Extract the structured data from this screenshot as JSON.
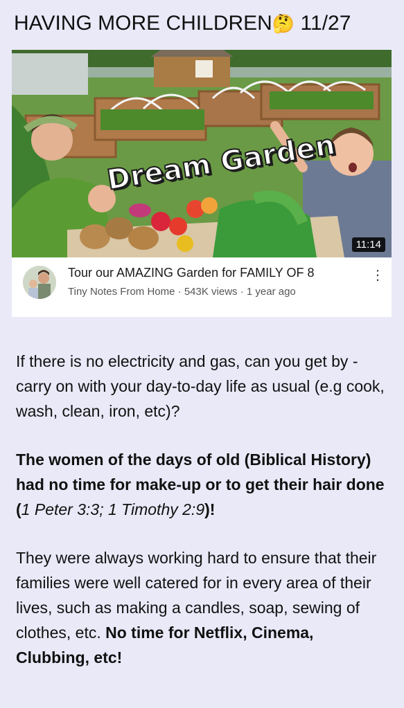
{
  "header": {
    "title": "HAVING MORE CHILDREN",
    "emoji": "🤔",
    "page_counter": "11/27"
  },
  "video": {
    "thumbnail_text": "Dream Garden",
    "duration": "11:14",
    "title": "Tour our AMAZING Garden for FAMILY OF 8",
    "channel": "Tiny Notes From Home",
    "views": "543K views",
    "age": "1 year ago",
    "separator": " · ",
    "menu_icon": "more-vertical-icon"
  },
  "paragraphs": {
    "p1": "If there is no electricity and gas, can you get by - carry on with your day-to-day life as usual (e.g cook, wash, clean, iron, etc)?",
    "p2_bold": "The women of the days of old (Biblical History) had no time for make-up or to get their hair done (",
    "p2_ref": "1 Peter 3:3; 1 Timothy 2:9",
    "p2_end": ")!",
    "p3_regular": "They were always working hard to ensure that their families were well catered for in every area of their lives, such as making a candles, soap, sewing of clothes, etc. ",
    "p3_bold": "No time for Netflix, Cinema, Clubbing, etc!"
  }
}
